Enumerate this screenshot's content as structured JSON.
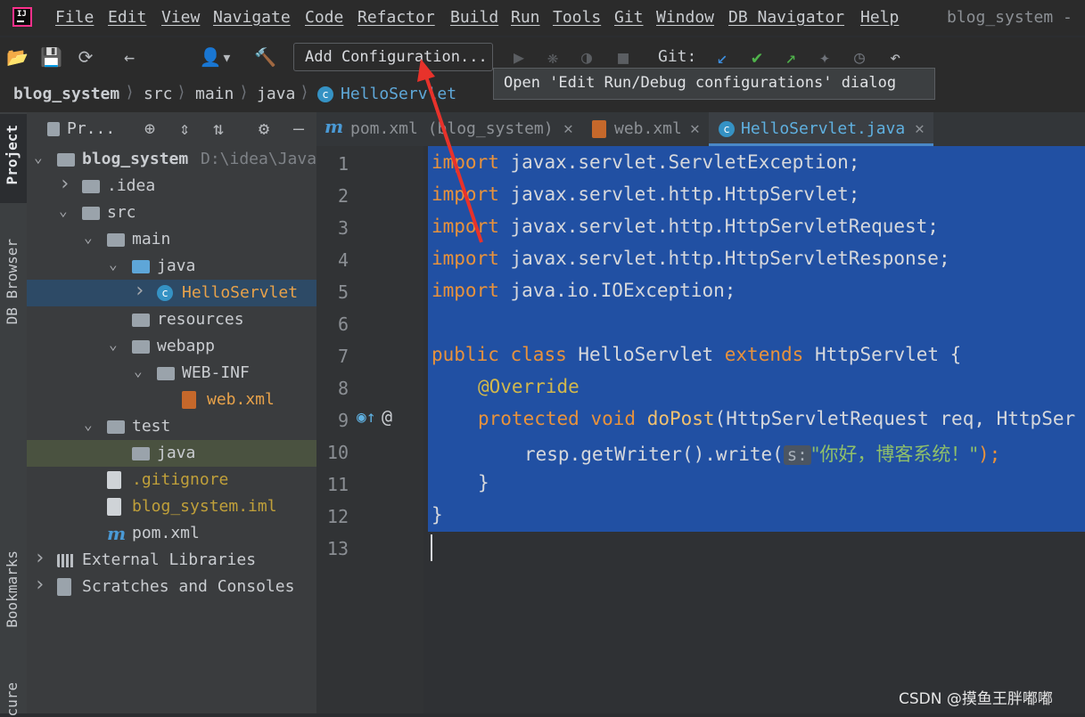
{
  "menu": [
    "File",
    "Edit",
    "View",
    "Navigate",
    "Code",
    "Refactor",
    "Build",
    "Run",
    "Tools",
    "Git",
    "Window",
    "DB Navigator",
    "Help"
  ],
  "window_title": "blog_system -",
  "toolbar": {
    "add_config_label": "Add Configuration...",
    "git_label": "Git:",
    "tooltip": "Open 'Edit Run/Debug configurations' dialog"
  },
  "breadcrumb": [
    "blog_system",
    "src",
    "main",
    "java",
    "HelloServlet"
  ],
  "side_tabs": {
    "project": "Project",
    "db_browser": "DB Browser",
    "bookmarks": "Bookmarks",
    "structure": "cure"
  },
  "project_panel": {
    "title": "Pr...",
    "tree": [
      {
        "label": "blog_system",
        "extra": "D:\\idea\\Java",
        "indent": 0,
        "arrow": "down",
        "icon": "folder"
      },
      {
        "label": ".idea",
        "indent": 1,
        "arrow": "right",
        "icon": "folder"
      },
      {
        "label": "src",
        "indent": 1,
        "arrow": "down",
        "icon": "folder"
      },
      {
        "label": "main",
        "indent": 2,
        "arrow": "down",
        "icon": "folder"
      },
      {
        "label": "java",
        "indent": 3,
        "arrow": "down",
        "icon": "folder-blue"
      },
      {
        "label": "HelloServlet",
        "indent": 4,
        "arrow": "right",
        "icon": "class",
        "selected": true
      },
      {
        "label": "resources",
        "indent": 3,
        "arrow": "",
        "icon": "folder"
      },
      {
        "label": "webapp",
        "indent": 3,
        "arrow": "down",
        "icon": "folder"
      },
      {
        "label": "WEB-INF",
        "indent": 4,
        "arrow": "down",
        "icon": "folder"
      },
      {
        "label": "web.xml",
        "indent": 5,
        "arrow": "",
        "icon": "xml"
      },
      {
        "label": "test",
        "indent": 2,
        "arrow": "down",
        "icon": "folder"
      },
      {
        "label": "java",
        "indent": 3,
        "arrow": "",
        "icon": "folder-green",
        "highlight": true
      },
      {
        "label": ".gitignore",
        "indent": 2,
        "arrow": "",
        "icon": "file"
      },
      {
        "label": "blog_system.iml",
        "indent": 2,
        "arrow": "",
        "icon": "file"
      },
      {
        "label": "pom.xml",
        "indent": 2,
        "arrow": "",
        "icon": "maven"
      },
      {
        "label": "External Libraries",
        "indent": 0,
        "arrow": "right",
        "icon": "library"
      },
      {
        "label": "Scratches and Consoles",
        "indent": 0,
        "arrow": "right",
        "icon": "scratch"
      }
    ]
  },
  "editor_tabs": [
    {
      "label": "pom.xml (blog_system)",
      "icon": "maven"
    },
    {
      "label": "web.xml",
      "icon": "xml"
    },
    {
      "label": "HelloServlet.java",
      "icon": "class",
      "active": true
    }
  ],
  "line_numbers": [
    "1",
    "2",
    "3",
    "4",
    "5",
    "6",
    "7",
    "8",
    "9",
    "10",
    "11",
    "12",
    "13"
  ],
  "code": {
    "l1": "javax.servlet.ServletException;",
    "l2": "javax.servlet.http.HttpServlet;",
    "l3": "javax.servlet.http.HttpServletRequest;",
    "l4": "javax.servlet.http.HttpServletResponse;",
    "l5": "java.io.IOException;",
    "import_kw": "import",
    "public_kw": "public",
    "class_kw": "class",
    "class_name": "HelloServlet",
    "extends_kw": "extends",
    "super_name": "HttpServlet {",
    "annotation": "@Override",
    "protected_kw": "protected",
    "void_kw": "void",
    "method": "doPost",
    "params": "(HttpServletRequest req, HttpSer",
    "l10_pre": "resp.getWriter().write(",
    "hint": "s:",
    "string": "\"你好，博客系统！\"",
    "l10_post": ");",
    "close_inner": "}",
    "close_outer": "}"
  },
  "watermark": "CSDN @摸鱼王胖嘟嘟"
}
